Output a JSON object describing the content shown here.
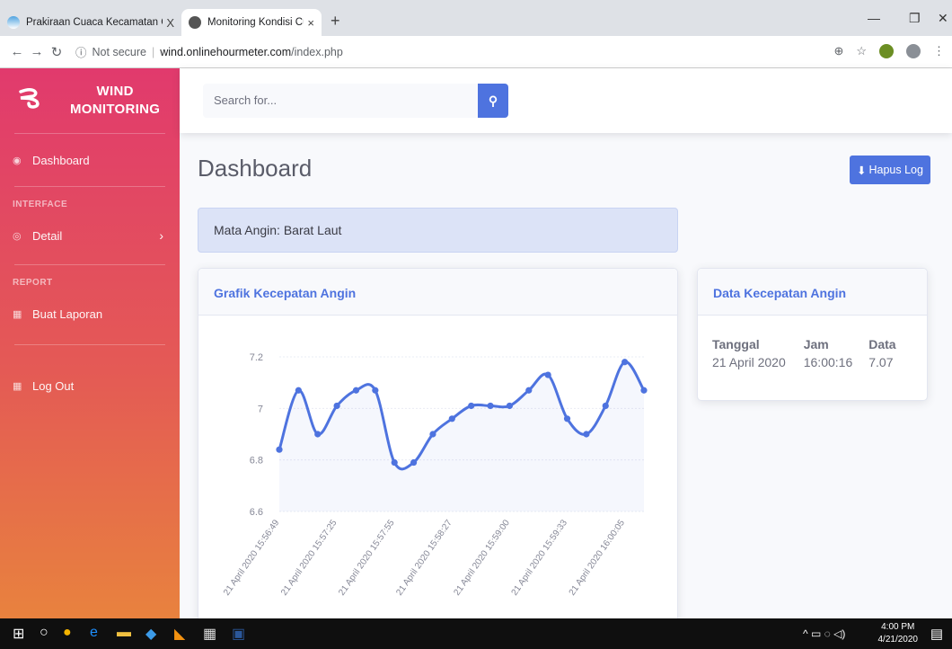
{
  "browser": {
    "tabs": [
      {
        "title": "Prakiraan Cuaca Kecamatan Gres",
        "close": "X"
      },
      {
        "title": "Monitoring Kondisi Cuaca",
        "close": "×"
      }
    ],
    "new_tab": "+",
    "security": "Not secure",
    "url_host": "wind.onlinehourmeter.com",
    "url_path": "/index.php"
  },
  "sidebar": {
    "brand_line1": "WIND",
    "brand_line2": "MONITORING",
    "items": [
      {
        "label": "Dashboard"
      },
      {
        "heading": "INTERFACE"
      },
      {
        "label": "Detail"
      },
      {
        "heading": "REPORT"
      },
      {
        "label": "Buat Laporan"
      },
      {
        "label": "Log Out"
      }
    ]
  },
  "topbar": {
    "search_placeholder": "Search for..."
  },
  "main": {
    "title": "Dashboard",
    "hapus_label": "Hapus Log",
    "alert_text": "Mata Angin: Barat Laut",
    "chart_card_title": "Grafik Kecepatan Angin",
    "data_card_title": "Data Kecepatan Angin",
    "table": {
      "headers": [
        "Tanggal",
        "Jam",
        "Data"
      ],
      "row": [
        "21 April 2020",
        "16:00:16",
        "7.07"
      ]
    }
  },
  "chart_data": {
    "type": "line",
    "title": "",
    "xlabel": "",
    "ylabel": "",
    "ylim": [
      6.6,
      7.2
    ],
    "yticks": [
      6.6,
      6.8,
      7,
      7.2
    ],
    "x": [
      "21 April 2020 15:56:49",
      "",
      "",
      "",
      "",
      "",
      "21 April 2020 15:57:25",
      "",
      "",
      "",
      "",
      "21 April 2020 15:57:55",
      "",
      "",
      "",
      "",
      "21 April 2020 15:58:27",
      "",
      "",
      "",
      "",
      "21 April 2020 15:59:00",
      "",
      "",
      "",
      "",
      "21 April 2020 15:59:33",
      "",
      "",
      "",
      "",
      "21 April 2020 16:00:05"
    ],
    "xtick_labels": [
      "21 April 2020 15:56:49",
      "21 April 2020 15:57:25",
      "21 April 2020 15:57:55",
      "21 April 2020 15:58:27",
      "21 April 2020 15:59:00",
      "21 April 2020 15:59:33",
      "21 April 2020 16:00:05"
    ],
    "series": [
      {
        "values": [
          6.84,
          7.07,
          6.9,
          7.01,
          7.07,
          7.07,
          6.79,
          6.79,
          6.9,
          6.96,
          7.01,
          7.01,
          7.01,
          7.07,
          7.13,
          6.96,
          6.9,
          7.01,
          7.18,
          7.07
        ]
      }
    ],
    "color": "#4e73df",
    "grid": true
  },
  "taskbar": {
    "time": "4:00 PM",
    "date": "4/21/2020"
  }
}
